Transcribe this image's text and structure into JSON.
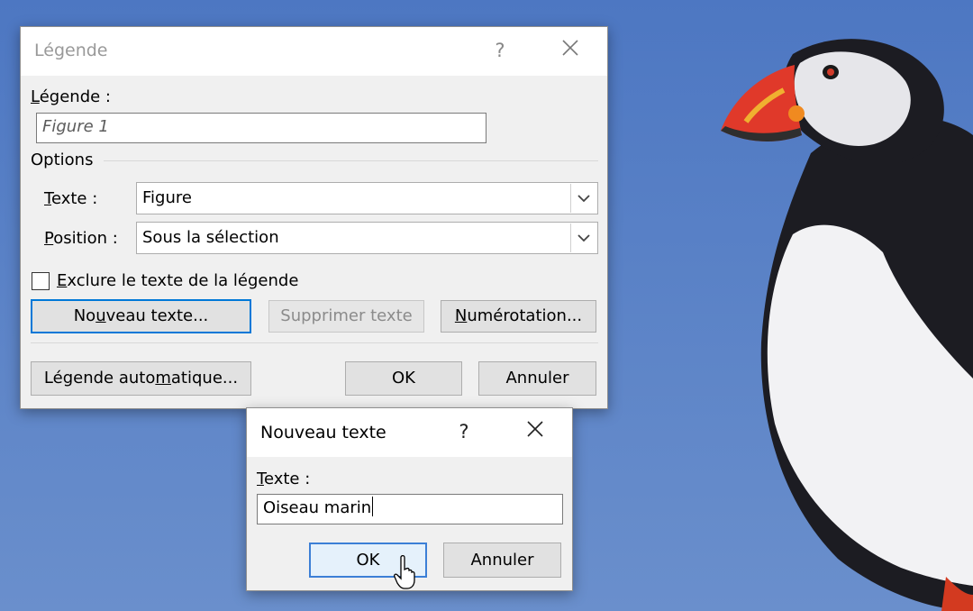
{
  "background": {
    "sky_color": "#5a82c4"
  },
  "main_dialog": {
    "title": "Légende",
    "help_icon": "?",
    "close_icon": "close-icon",
    "caption_label_prefix": "L",
    "caption_label_rest": "égende :",
    "caption_value": "Figure 1",
    "options_label": "Options",
    "text_label_key": "T",
    "text_label_rest": "exte :",
    "text_value": "Figure",
    "position_label_key": "P",
    "position_label_rest": "osition :",
    "position_value": "Sous la sélection",
    "exclude_key": "E",
    "exclude_rest": "xclure le texte de la légende",
    "exclude_checked": false,
    "new_text_pre": "No",
    "new_text_key": "u",
    "new_text_post": "veau texte...",
    "delete_text": "Supprimer texte",
    "numbering_key": "N",
    "numbering_rest": "umérotation...",
    "autocaption_pre": "Légende auto",
    "autocaption_key": "m",
    "autocaption_post": "atique...",
    "ok": "OK",
    "cancel": "Annuler"
  },
  "new_text_dialog": {
    "title": "Nouveau texte",
    "help_icon": "?",
    "close_icon": "close-icon",
    "label_key": "T",
    "label_rest": "exte :",
    "value": "Oiseau marin",
    "ok": "OK",
    "cancel": "Annuler"
  },
  "cursor": {
    "icon": "mouse-pointer-icon"
  },
  "accent_color": "#0078d7"
}
